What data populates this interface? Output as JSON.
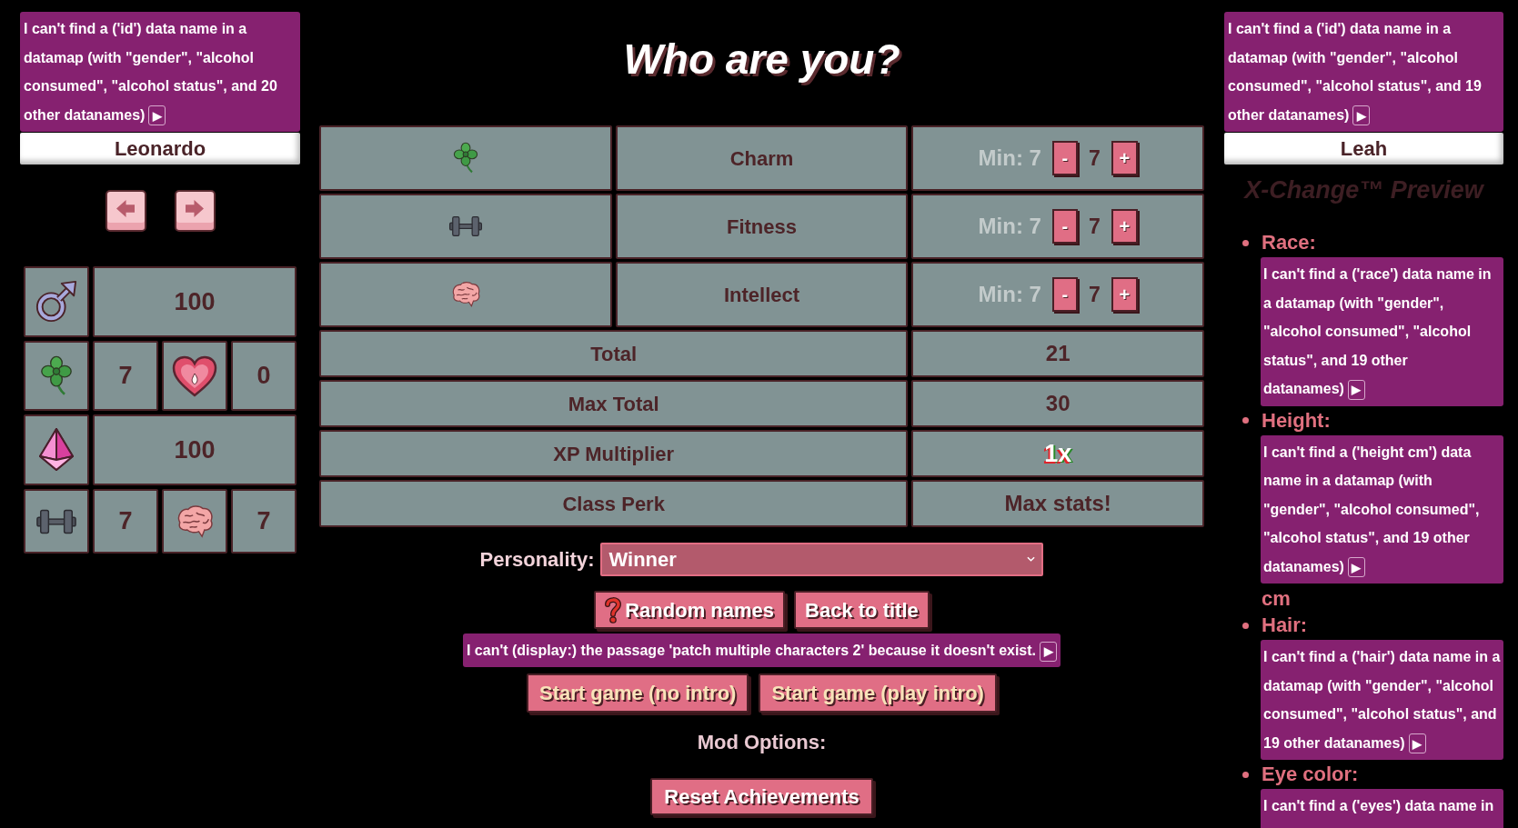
{
  "left_character": {
    "error": {
      "text": "I can't find a ('id') data name in a datamap (with \"gender\", \"alcohol consumed\", \"alcohol status\", and 20 other datanames)",
      "toggle": "▶"
    },
    "name_value": "Leonardo"
  },
  "summary_grid": {
    "rows": [
      {
        "cells": [
          {
            "kind": "icon"
          },
          {
            "kind": "value",
            "text": "100"
          }
        ]
      },
      {
        "cells": [
          {
            "kind": "icon"
          },
          {
            "kind": "value",
            "text": "7"
          },
          {
            "kind": "icon"
          },
          {
            "kind": "value",
            "text": "0"
          }
        ]
      },
      {
        "cells": [
          {
            "kind": "icon"
          },
          {
            "kind": "value",
            "text": "100"
          }
        ]
      },
      {
        "cells": [
          {
            "kind": "icon"
          },
          {
            "kind": "value",
            "text": "7"
          },
          {
            "kind": "icon"
          },
          {
            "kind": "value",
            "text": "7"
          }
        ]
      }
    ]
  },
  "title": "Who are you?",
  "stats": [
    {
      "label": "Charm",
      "min": "Min: 7",
      "value": "7",
      "decrease": "-",
      "increase": "+"
    },
    {
      "label": "Fitness",
      "min": "Min: 7",
      "value": "7",
      "decrease": "-",
      "increase": "+"
    },
    {
      "label": "Intellect",
      "min": "Min: 7",
      "value": "7",
      "decrease": "-",
      "increase": "+"
    }
  ],
  "totals": [
    {
      "label": "Total",
      "value": "21",
      "kind": "plain"
    },
    {
      "label": "Max Total",
      "value": "30",
      "kind": "plain"
    },
    {
      "label": "XP Multiplier",
      "value": "1x",
      "kind": "festive"
    },
    {
      "label": "Class Perk",
      "value": "Max stats!",
      "kind": "plain"
    }
  ],
  "personality": {
    "label": "Personality:",
    "value": "Winner"
  },
  "action_buttons": [
    {
      "label": "Random names",
      "icon": true
    },
    {
      "label": "Back to title",
      "icon": false
    }
  ],
  "passage_error": {
    "text": "I can't (display:) the passage 'patch multiple characters 2' because it doesn't exist.",
    "toggle": "▶"
  },
  "start_buttons": [
    {
      "label": "Start game (no intro)"
    },
    {
      "label": "Start game (play intro)"
    }
  ],
  "mod_options": {
    "title": "Mod Options:",
    "buttons": [
      {
        "label": "Reset Achievements"
      }
    ]
  },
  "right_character": {
    "error": {
      "text": "I can't find a ('id') data name in a datamap (with \"gender\", \"alcohol consumed\", \"alcohol status\", and 19 other datanames)",
      "toggle": "▶"
    },
    "name_value": "Leah"
  },
  "preview": {
    "title": "X-Change™ Preview",
    "items": [
      {
        "label": "Race:",
        "error": {
          "text": "I can't find a ('race') data name in a datamap (with \"gender\", \"alcohol consumed\", \"alcohol status\", and 19 other datanames)",
          "toggle": "▶"
        }
      },
      {
        "label": "Height:",
        "error": {
          "text": "I can't find a ('height cm') data name in a datamap (with \"gender\", \"alcohol consumed\", \"alcohol status\", and 19 other datanames)",
          "toggle": "▶"
        },
        "suffix": "cm"
      },
      {
        "label": "Hair:",
        "error": {
          "text": "I can't find a ('hair') data name in a datamap (with \"gender\", \"alcohol consumed\", \"alcohol status\", and 19 other datanames)",
          "toggle": "▶"
        }
      },
      {
        "label": "Eye color:",
        "error": {
          "text": "I can't find a ('eyes') data name in"
        }
      }
    ]
  }
}
